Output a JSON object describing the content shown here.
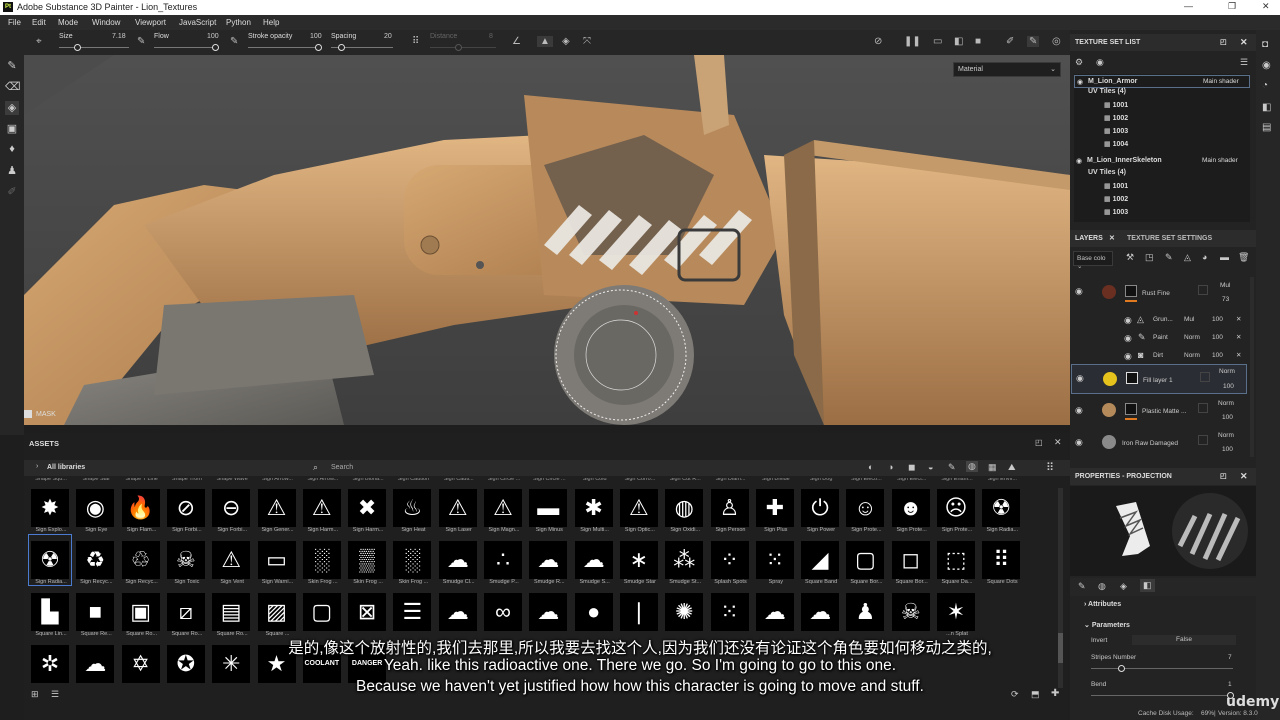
{
  "window": {
    "title": "Adobe Substance 3D Painter - Lion_Textures",
    "app_icon": "Pt"
  },
  "menu": [
    "File",
    "Edit",
    "Mode",
    "Window",
    "Viewport",
    "JavaScript",
    "Python",
    "Help"
  ],
  "toolbar": {
    "size_label": "Size",
    "size_value": "7.18",
    "flow_label": "Flow",
    "flow_value": "100",
    "stroke_opacity_label": "Stroke opacity",
    "stroke_opacity_value": "100",
    "spacing_label": "Spacing",
    "spacing_value": "20",
    "distance_label": "Distance",
    "distance_value": "8"
  },
  "viewport": {
    "material_mode": "Material",
    "mask_label": "MASK"
  },
  "texture_set_list": {
    "title": "TEXTURE SET LIST",
    "sets": [
      {
        "name": "M_Lion_Armor",
        "shader": "Main shader",
        "uv_header": "UV Tiles (4)",
        "tiles": [
          "1001",
          "1002",
          "1003",
          "1004"
        ]
      },
      {
        "name": "M_Lion_InnerSkeleton",
        "shader": "Main shader",
        "uv_header": "UV Tiles (4)",
        "tiles": [
          "1001",
          "1002",
          "1003"
        ]
      }
    ]
  },
  "layers": {
    "tab_layers": "LAYERS",
    "tab_settings": "TEXTURE SET SETTINGS",
    "channel": "Base colo",
    "items": [
      {
        "name": "Rust Fine",
        "blend": "Mul",
        "opacity": "73"
      },
      {
        "name": "Grun...",
        "blend": "Mul",
        "opacity": "100"
      },
      {
        "name": "Paint",
        "blend": "Norm",
        "opacity": "100"
      },
      {
        "name": "Dirt",
        "blend": "Norm",
        "opacity": "100"
      },
      {
        "name": "Fill layer 1",
        "blend": "Norm",
        "opacity": "100"
      },
      {
        "name": "Plastic Matte ...",
        "blend": "Norm",
        "opacity": "100"
      },
      {
        "name": "Iron Raw Damaged",
        "blend": "Norm",
        "opacity": "100"
      }
    ]
  },
  "properties": {
    "title": "PROPERTIES - PROJECTION",
    "attributes": "Attributes",
    "parameters": "Parameters",
    "invert_label": "Invert",
    "invert_value": "False",
    "stripes_label": "Stripes Number",
    "stripes_value": "7",
    "bend_label": "Bend",
    "bend_value": "1"
  },
  "assets": {
    "title": "ASSETS",
    "library": "All libraries",
    "search_placeholder": "Search",
    "top_cut_labels": [
      "Shape Squ...",
      "Shape Star",
      "Shape T Line",
      "Shape Trom",
      "Shape Wave",
      "Sign Arrow...",
      "Sign Arrow...",
      "Sign Bioha...",
      "Sign Caution",
      "Sign Cauti...",
      "Sign Circle ...",
      "Sign Circle ...",
      "Sign Cold",
      "Sign Corro...",
      "Sign Cut R...",
      "Sign Diam...",
      "Sign Divide",
      "Sign Dog",
      "Sign Electr...",
      "Sign Elect...",
      "Sign Enam...",
      "Sign Envir..."
    ],
    "row1": [
      {
        "label": "Sign Explo...",
        "g": "✸"
      },
      {
        "label": "Sign Eye",
        "g": "◉"
      },
      {
        "label": "Sign Flam...",
        "g": "🔥"
      },
      {
        "label": "Sign Forbi...",
        "g": "⊘"
      },
      {
        "label": "Sign Forbi...",
        "g": "⊖"
      },
      {
        "label": "Sign Gener...",
        "g": "⚠"
      },
      {
        "label": "Sign Harm...",
        "g": "⚠"
      },
      {
        "label": "Sign Harm...",
        "g": "✖"
      },
      {
        "label": "Sign Heat",
        "g": "♨"
      },
      {
        "label": "Sign Laser",
        "g": "⚠"
      },
      {
        "label": "Sign Magn...",
        "g": "⚠"
      },
      {
        "label": "Sign Minus",
        "g": "▬"
      },
      {
        "label": "Sign Multi...",
        "g": "✱"
      },
      {
        "label": "Sign Optic...",
        "g": "⚠"
      },
      {
        "label": "Sign Oxidi...",
        "g": "◍"
      },
      {
        "label": "Sign Person",
        "g": "♙"
      },
      {
        "label": "Sign Plus",
        "g": "✚"
      },
      {
        "label": "Sign Power",
        "g": "⏻"
      },
      {
        "label": "Sign Prote...",
        "g": "☺"
      },
      {
        "label": "Sign Prote...",
        "g": "☻"
      },
      {
        "label": "Sign Prote...",
        "g": "☹"
      },
      {
        "label": "Sign Radia...",
        "g": "☢"
      }
    ],
    "row2": [
      {
        "label": "Sign Radia...",
        "g": "☢"
      },
      {
        "label": "Sign Recyc...",
        "g": "♻"
      },
      {
        "label": "Sign Recyc...",
        "g": "♲"
      },
      {
        "label": "Sign Toxic",
        "g": "☠"
      },
      {
        "label": "Sign Vent",
        "g": "⚠"
      },
      {
        "label": "Sign Warni...",
        "g": "▭"
      },
      {
        "label": "Skin Frog ...",
        "g": "░"
      },
      {
        "label": "Skin Frog ...",
        "g": "▒"
      },
      {
        "label": "Skin Frog ...",
        "g": "░"
      },
      {
        "label": "Smudge Cl...",
        "g": "☁"
      },
      {
        "label": "Smudge P...",
        "g": "∴"
      },
      {
        "label": "Smudge R...",
        "g": "☁"
      },
      {
        "label": "Smudge S...",
        "g": "☁"
      },
      {
        "label": "Smudge Star",
        "g": "∗"
      },
      {
        "label": "Smudge St...",
        "g": "⁂"
      },
      {
        "label": "Splash Spots",
        "g": "⁘"
      },
      {
        "label": "Spray",
        "g": "⁙"
      },
      {
        "label": "Square Band",
        "g": "◢"
      },
      {
        "label": "Square Bor...",
        "g": "▢"
      },
      {
        "label": "Square Bor...",
        "g": "◻"
      },
      {
        "label": "Square Da...",
        "g": "⬚"
      },
      {
        "label": "Square Dots",
        "g": "⠿"
      }
    ],
    "row3": [
      {
        "label": "Square Lin...",
        "g": "▙"
      },
      {
        "label": "Square Re...",
        "g": "■"
      },
      {
        "label": "Square Ro...",
        "g": "▣"
      },
      {
        "label": "Square Ro...",
        "g": "⧄"
      },
      {
        "label": "Square Ro...",
        "g": "▤"
      },
      {
        "label": "Square ...",
        "g": "▨"
      },
      {
        "label": "",
        "g": "▢"
      },
      {
        "label": "",
        "g": "⊠"
      },
      {
        "label": "",
        "g": "☰"
      },
      {
        "label": "",
        "g": "☁"
      },
      {
        "label": "",
        "g": "∞"
      },
      {
        "label": "",
        "g": "☁"
      },
      {
        "label": "",
        "g": "●"
      },
      {
        "label": "",
        "g": "❘"
      },
      {
        "label": "",
        "g": "✺"
      },
      {
        "label": "",
        "g": "⁙"
      },
      {
        "label": "",
        "g": "☁"
      },
      {
        "label": "",
        "g": "☁"
      },
      {
        "label": "",
        "g": "♟"
      },
      {
        "label": "",
        "g": "☠"
      },
      {
        "label": "...n Splat",
        "g": "✶"
      }
    ],
    "row4": [
      {
        "label": "",
        "g": "✲"
      },
      {
        "label": "",
        "g": "☁"
      },
      {
        "label": "",
        "g": "✡"
      },
      {
        "label": "",
        "g": "✪"
      },
      {
        "label": "",
        "g": "✳"
      },
      {
        "label": "",
        "g": "★"
      },
      {
        "label": "",
        "g": "COOLANT"
      },
      {
        "label": "",
        "g": "DANGER"
      }
    ]
  },
  "subtitles": {
    "zh": "是的,像这个放射性的,我们去那里,所以我要去找这个人,因为我们还没有论证这个角色要如何移动之类的,",
    "en1": "Yeah. like this radioactive one. There we go. So I'm going to go to this one.",
    "en2": "Because we haven't yet justified how how this character is going to move and stuff."
  },
  "status": {
    "cache": "Cache Disk Usage:",
    "cache_pct": "69%",
    "version": "Version: 8.3.0",
    "watermark": "udemy"
  }
}
